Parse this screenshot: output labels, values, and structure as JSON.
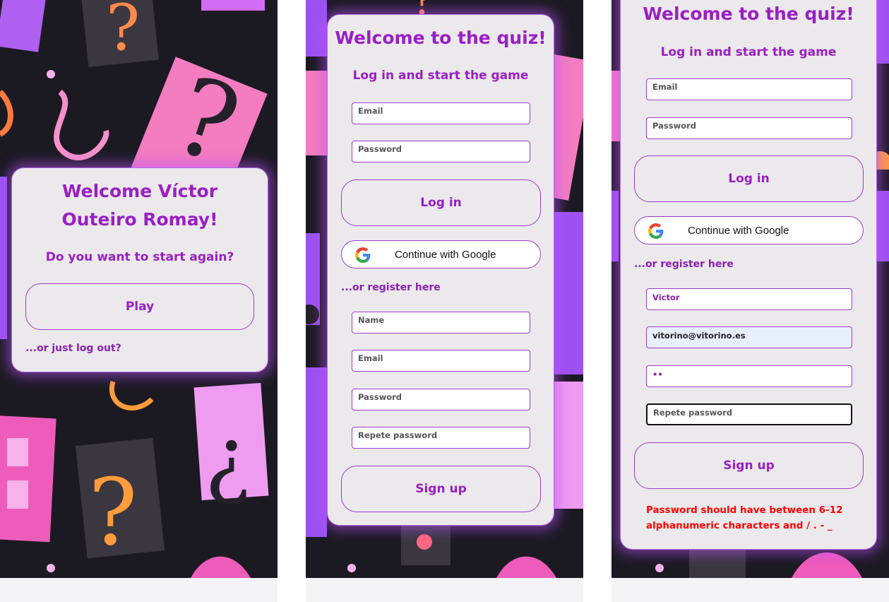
{
  "screen1": {
    "title": "Welcome Víctor Outeiro Romay!",
    "subtitle": "Do you want to start again?",
    "play_label": "Play",
    "logout_link": "...or just log out?"
  },
  "screen2": {
    "title": "Welcome to the quiz!",
    "subtitle": "Log in and start the game",
    "login_email_placeholder": "Email",
    "login_password_placeholder": "Password",
    "login_label": "Log in",
    "google_label": "Continue with Google",
    "register_link": "...or register here",
    "name_placeholder": "Name",
    "email_placeholder": "Email",
    "password_placeholder": "Password",
    "repeat_password_placeholder": "Repete password",
    "signup_label": "Sign up"
  },
  "screen3": {
    "title": "Welcome to the quiz!",
    "subtitle": "Log in and start the game",
    "login_email_placeholder": "Email",
    "login_password_placeholder": "Password",
    "login_label": "Log in",
    "google_label": "Continue with Google",
    "register_link": "...or register here",
    "name_value": "Victor",
    "email_value": "vitorino@vitorino.es",
    "password_value": "••",
    "repeat_password_placeholder": "Repete password",
    "signup_label": "Sign up",
    "error_message": "Password should have between 6-12 alphanumeric characters and / . - _"
  },
  "colors": {
    "accent": "#9a1fc4",
    "card_bg": "#ebe9ec",
    "error": "#ff0000",
    "background": "#1b1a22",
    "glow": "#be50ff"
  }
}
